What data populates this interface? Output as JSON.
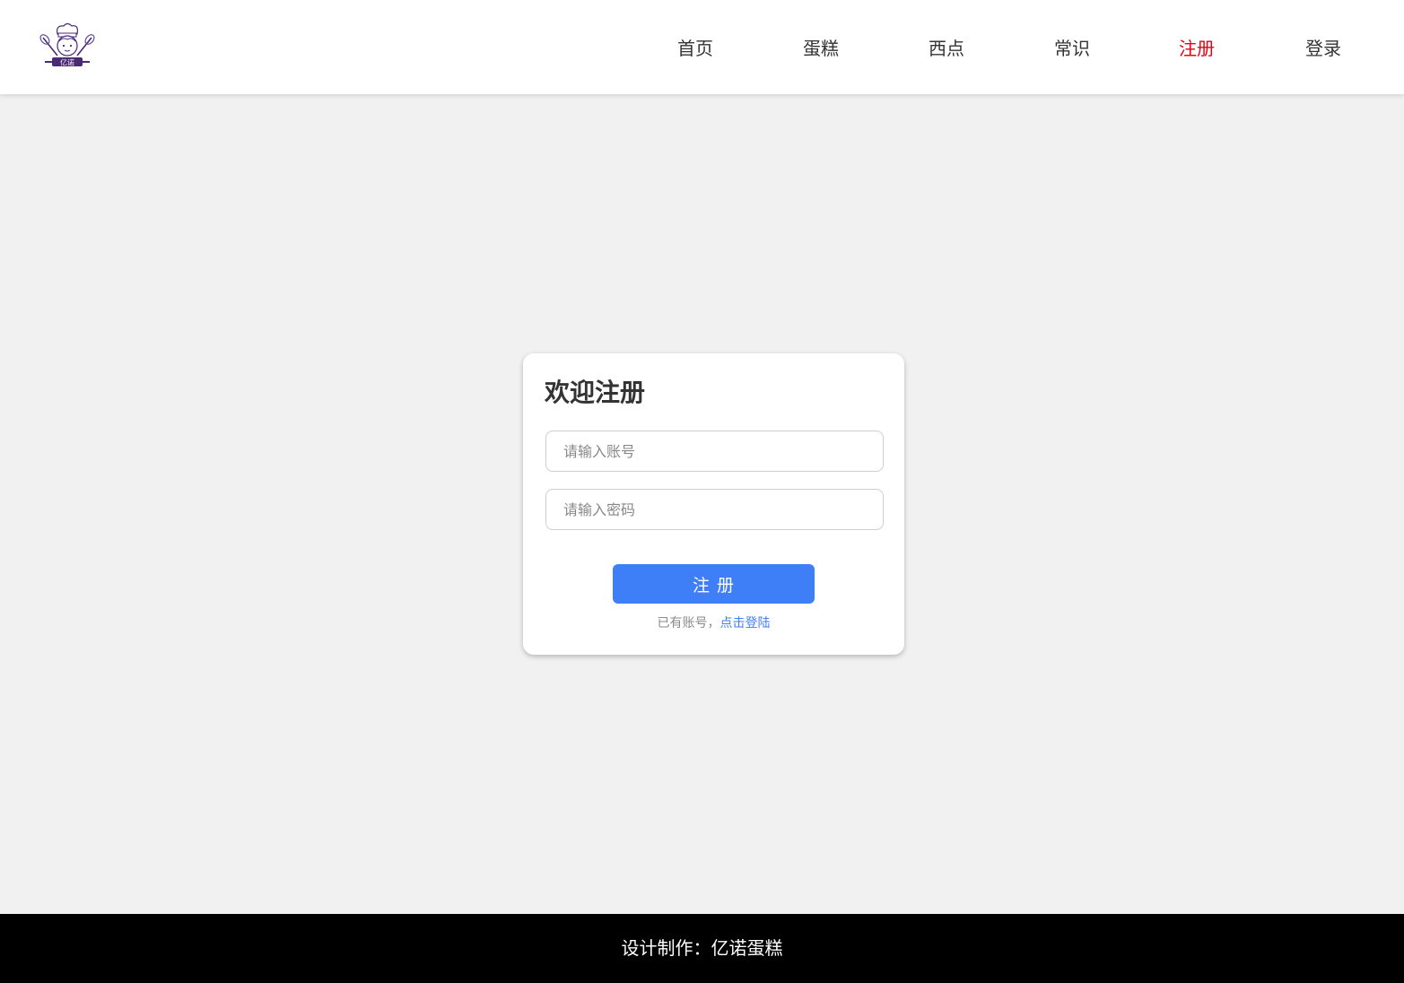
{
  "colors": {
    "accent": "#3e7ef7",
    "nav_active": "#e60012",
    "nav_default": "#333333",
    "link": "#3e7ef7",
    "footer_bg": "#000000",
    "page_bg": "#f1f1f1",
    "logo": "#4a2a75"
  },
  "header": {
    "logo": {
      "icon": "chef-logo-icon",
      "text": "亿诺"
    },
    "nav": [
      {
        "label": "首页",
        "active": false
      },
      {
        "label": "蛋糕",
        "active": false
      },
      {
        "label": "西点",
        "active": false
      },
      {
        "label": "常识",
        "active": false
      },
      {
        "label": "注册",
        "active": true
      },
      {
        "label": "登录",
        "active": false
      }
    ]
  },
  "register_form": {
    "title": "欢迎注册",
    "account_placeholder": "请输入账号",
    "account_value": "",
    "password_placeholder": "请输入密码",
    "password_value": "",
    "submit_label": "注 册",
    "login_hint_prefix": "已有账号，",
    "login_link": "点击登陆"
  },
  "footer": {
    "text": "设计制作：亿诺蛋糕"
  }
}
